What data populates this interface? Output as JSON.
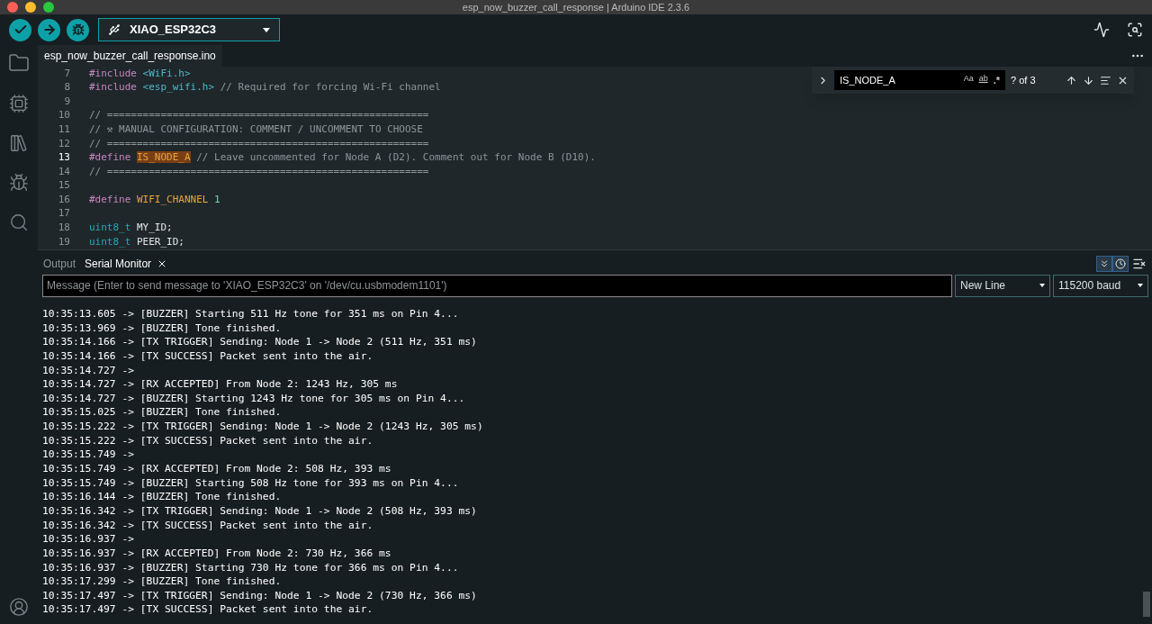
{
  "window": {
    "title": "esp_now_buzzer_call_response | Arduino IDE 2.3.6"
  },
  "board": {
    "name": "XIAO_ESP32C3"
  },
  "editor_tab": {
    "label": "esp_now_buzzer_call_response.ino"
  },
  "code_lines": [
    {
      "number": "7",
      "current": false,
      "tokens": [
        {
          "kind": "keyword",
          "text": "#include"
        },
        {
          "kind": "include",
          "text": "<WiFi.h>",
          "space_before": true
        }
      ]
    },
    {
      "number": "8",
      "current": false,
      "tokens": [
        {
          "kind": "keyword",
          "text": "#include"
        },
        {
          "kind": "include",
          "text": "<esp_wifi.h>",
          "space_before": true
        },
        {
          "kind": "comment",
          "text": "// Required for forcing Wi-Fi channel",
          "space_before": true
        }
      ]
    },
    {
      "number": "9",
      "current": false
    },
    {
      "number": "10",
      "current": false,
      "tokens": [
        {
          "kind": "comment",
          "text": "// ======================================================"
        }
      ]
    },
    {
      "number": "11",
      "current": false,
      "tokens": [
        {
          "kind": "comment",
          "text": "// ⚒ MANUAL CONFIGURATION: COMMENT / UNCOMMENT TO CHOOSE"
        }
      ]
    },
    {
      "number": "12",
      "current": false,
      "tokens": [
        {
          "kind": "comment",
          "text": "// ======================================================"
        }
      ]
    },
    {
      "number": "13",
      "current": true,
      "tokens": [
        {
          "kind": "keyword",
          "text": "#define"
        },
        {
          "kind": "match",
          "text": "IS_NODE_A",
          "space_before": true
        },
        {
          "kind": "comment",
          "text": "// Leave uncommented for Node A (D2). Comment out for Node B (D10).",
          "space_before": true
        }
      ]
    },
    {
      "number": "14",
      "current": false,
      "tokens": [
        {
          "kind": "comment",
          "text": "// ======================================================"
        }
      ]
    },
    {
      "number": "15",
      "current": false
    },
    {
      "number": "16",
      "current": false,
      "tokens": [
        {
          "kind": "keyword",
          "text": "#define"
        },
        {
          "kind": "macro",
          "text": "WIFI_CHANNEL",
          "space_before": true
        },
        {
          "kind": "number",
          "text": "1",
          "space_before": true
        }
      ]
    },
    {
      "number": "17",
      "current": false
    },
    {
      "number": "18",
      "current": false,
      "tokens": [
        {
          "kind": "type",
          "text": "uint8_t"
        },
        {
          "kind": "plain",
          "text": "MY_ID;",
          "space_before": true
        }
      ]
    },
    {
      "number": "19",
      "current": false,
      "tokens": [
        {
          "kind": "type",
          "text": "uint8_t"
        },
        {
          "kind": "plain",
          "text": "PEER_ID;",
          "space_before": true
        }
      ]
    }
  ],
  "find": {
    "value": "IS_NODE_A",
    "match_case": "Aa",
    "whole_word": "ab",
    "regex": ".*",
    "count": "? of 3"
  },
  "panel_tabs": [
    {
      "label": "Output",
      "selected": false,
      "closable": false
    },
    {
      "label": "Serial Monitor",
      "selected": true,
      "closable": true
    }
  ],
  "serial_toolbar": {
    "autoscroll": true,
    "timestamp": true
  },
  "message": {
    "placeholder": "Message (Enter to send message to 'XIAO_ESP32C3' on '/dev/cu.usbmodem1101')"
  },
  "line_ending": "New Line",
  "baud": "115200 baud",
  "log": [
    "10:35:13.605 -> [BUZZER] Starting 511 Hz tone for 351 ms on Pin 4...",
    "10:35:13.969 -> [BUZZER] Tone finished.",
    "10:35:14.166 -> [TX TRIGGER] Sending: Node 1 -> Node 2 (511 Hz, 351 ms)",
    "10:35:14.166 -> [TX SUCCESS] Packet sent into the air.",
    "10:35:14.727 ->",
    "10:35:14.727 -> [RX ACCEPTED] From Node 2: 1243 Hz, 305 ms",
    "10:35:14.727 -> [BUZZER] Starting 1243 Hz tone for 305 ms on Pin 4...",
    "10:35:15.025 -> [BUZZER] Tone finished.",
    "10:35:15.222 -> [TX TRIGGER] Sending: Node 1 -> Node 2 (1243 Hz, 305 ms)",
    "10:35:15.222 -> [TX SUCCESS] Packet sent into the air.",
    "10:35:15.749 ->",
    "10:35:15.749 -> [RX ACCEPTED] From Node 2: 508 Hz, 393 ms",
    "10:35:15.749 -> [BUZZER] Starting 508 Hz tone for 393 ms on Pin 4...",
    "10:35:16.144 -> [BUZZER] Tone finished.",
    "10:35:16.342 -> [TX TRIGGER] Sending: Node 1 -> Node 2 (508 Hz, 393 ms)",
    "10:35:16.342 -> [TX SUCCESS] Packet sent into the air.",
    "10:35:16.937 ->",
    "10:35:16.937 -> [RX ACCEPTED] From Node 2: 730 Hz, 366 ms",
    "10:35:16.937 -> [BUZZER] Starting 730 Hz tone for 366 ms on Pin 4...",
    "10:35:17.299 -> [BUZZER] Tone finished.",
    "10:35:17.497 -> [TX TRIGGER] Sending: Node 1 -> Node 2 (730 Hz, 366 ms)",
    "10:35:17.497 -> [TX SUCCESS] Packet sent into the air."
  ]
}
